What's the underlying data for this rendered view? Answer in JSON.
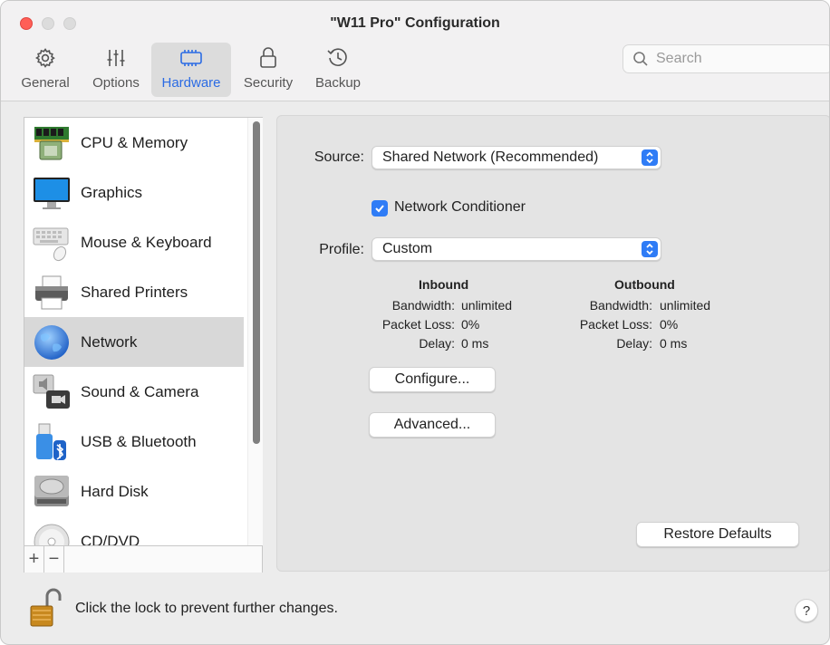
{
  "window": {
    "title": "\"W11 Pro\" Configuration"
  },
  "toolbar": {
    "items": [
      {
        "label": "General",
        "icon": "gear-icon"
      },
      {
        "label": "Options",
        "icon": "sliders-icon"
      },
      {
        "label": "Hardware",
        "icon": "chip-icon",
        "active": true
      },
      {
        "label": "Security",
        "icon": "lock-icon"
      },
      {
        "label": "Backup",
        "icon": "history-icon"
      }
    ],
    "search": {
      "placeholder": "Search",
      "value": ""
    }
  },
  "sidebar": {
    "items": [
      {
        "label": "CPU & Memory",
        "icon": "cpu-memory-icon"
      },
      {
        "label": "Graphics",
        "icon": "monitor-icon"
      },
      {
        "label": "Mouse & Keyboard",
        "icon": "keyboard-mouse-icon"
      },
      {
        "label": "Shared Printers",
        "icon": "printer-icon"
      },
      {
        "label": "Network",
        "icon": "globe-icon",
        "selected": true
      },
      {
        "label": "Sound & Camera",
        "icon": "speaker-camera-icon"
      },
      {
        "label": "USB & Bluetooth",
        "icon": "usb-bluetooth-icon"
      },
      {
        "label": "Hard Disk",
        "icon": "hard-disk-icon"
      },
      {
        "label": "CD/DVD",
        "icon": "disc-icon"
      }
    ],
    "add_label": "+",
    "remove_label": "−"
  },
  "network": {
    "source_label": "Source:",
    "source_value": "Shared Network (Recommended)",
    "conditioner_label": "Network Conditioner",
    "conditioner_checked": true,
    "profile_label": "Profile:",
    "profile_value": "Custom",
    "inbound": {
      "heading": "Inbound",
      "bandwidth_key": "Bandwidth:",
      "bandwidth": "unlimited",
      "packet_loss_key": "Packet Loss:",
      "packet_loss": "0%",
      "delay_key": "Delay:",
      "delay": "0 ms"
    },
    "outbound": {
      "heading": "Outbound",
      "bandwidth_key": "Bandwidth:",
      "bandwidth": "unlimited",
      "packet_loss_key": "Packet Loss:",
      "packet_loss": "0%",
      "delay_key": "Delay:",
      "delay": "0 ms"
    },
    "configure_label": "Configure...",
    "advanced_label": "Advanced...",
    "restore_label": "Restore Defaults"
  },
  "footer": {
    "lock_text": "Click the lock to prevent further changes.",
    "help_label": "?"
  },
  "colors": {
    "accent": "#2f7cf6",
    "selection": "#d8d8d8",
    "close": "#ff5f57"
  }
}
